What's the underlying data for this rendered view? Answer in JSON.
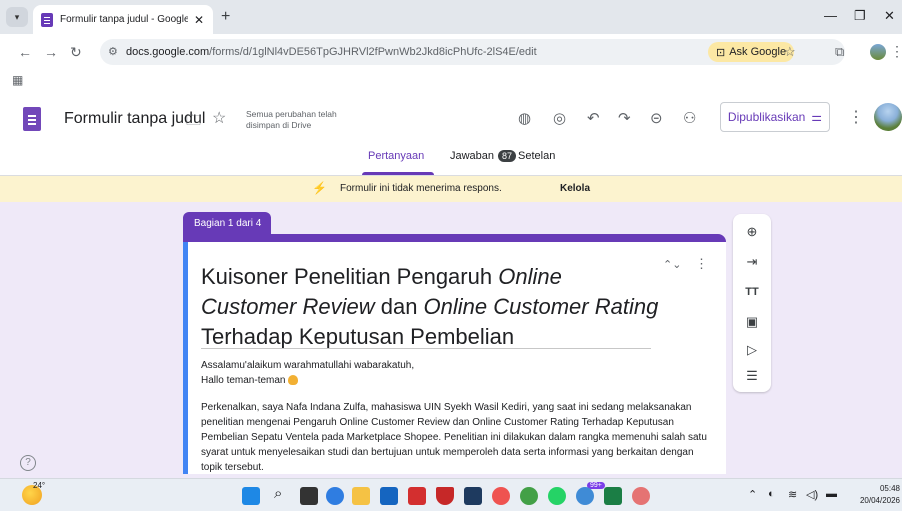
{
  "browser": {
    "tab_title": "Formulir tanpa judul - Google F",
    "url_host": "docs.google.com",
    "url_path": "/forms/d/1glNl4vDE56TpGJHRVl2fPwnWb2Jkd8icPhUfc-2lS4E/edit",
    "ask_google": "Ask Google"
  },
  "forms": {
    "title": "Formulir tanpa judul",
    "save_status": "Semua perubahan telah disimpan di Drive",
    "publish_label": "Dipublikasikan",
    "tabs": [
      {
        "label": "Pertanyaan"
      },
      {
        "label": "Jawaban",
        "count": "87"
      },
      {
        "label": "Setelan"
      }
    ]
  },
  "banner": {
    "text": "Formulir ini tidak menerima respons.",
    "action": "Kelola"
  },
  "section": {
    "label": "Bagian 1 dari 4"
  },
  "form_content": {
    "heading_1": "Kuisoner Penelitian Pengaruh ",
    "heading_2": "Online",
    "heading_3": "Customer Review",
    "heading_4": " dan ",
    "heading_5": "Online Customer Rating",
    "heading_6": "Terhadap Keputusan Pembelian",
    "greeting_1": "Assalamu'alaikum warahmatullahi wabarakatuh,",
    "greeting_2": "Hallo teman-teman",
    "paragraph": "Perkenalkan, saya Nafa Indana Zulfa, mahasiswa UIN Syekh Wasil Kediri, yang saat ini sedang melaksanakan penelitian mengenai Pengaruh Online Customer Review dan Online Customer Rating Terhadap Keputusan Pembelian Sepatu Ventela pada Marketplace Shopee. Penelitian ini dilakukan dalam rangka memenuhi salah satu syarat untuk menyelesaikan studi dan bertujuan untuk memperoleh data serta informasi yang berkaitan dengan topik tersebut."
  },
  "taskbar": {
    "temperature": "24°",
    "badge": "99+",
    "time": "05:48",
    "date": "20/04/2026"
  },
  "colors": {
    "accent": "#673ab7",
    "card_focus": "#4285f4",
    "banner_bg": "#fcf3cf",
    "page_bg": "#efe9f8"
  }
}
